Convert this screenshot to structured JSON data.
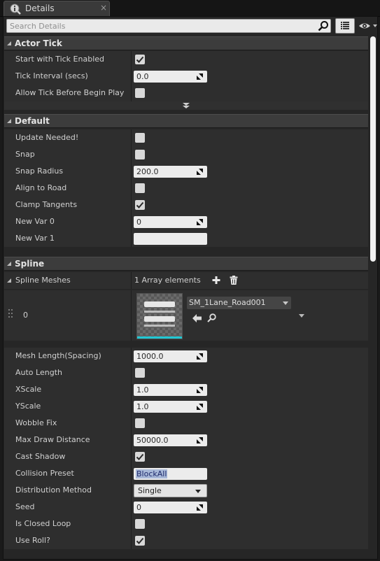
{
  "tab": {
    "title": "Details",
    "close_glyph": "×"
  },
  "search": {
    "placeholder": "Search Details",
    "value": ""
  },
  "icons": {
    "tab": "details-info-icon",
    "search": "magnifier-icon",
    "view_options": "list-view-icon",
    "visibility": "eye-icon"
  },
  "sections": {
    "actor_tick": {
      "title": "Actor Tick",
      "start_with_tick": {
        "label": "Start with Tick Enabled",
        "checked": true
      },
      "tick_interval": {
        "label": "Tick Interval (secs)",
        "value": "0.0"
      },
      "allow_tick": {
        "label": "Allow Tick Before Begin Play",
        "checked": false
      }
    },
    "default": {
      "title": "Default",
      "update_needed": {
        "label": "Update Needed!",
        "checked": false
      },
      "snap": {
        "label": "Snap",
        "checked": false
      },
      "snap_radius": {
        "label": "Snap Radius",
        "value": "200.0"
      },
      "align_to_road": {
        "label": "Align to Road",
        "checked": false
      },
      "clamp_tangents": {
        "label": "Clamp Tangents",
        "checked": true
      },
      "new_var_0": {
        "label": "New Var 0",
        "value": "0"
      },
      "new_var_1": {
        "label": "New Var 1",
        "value": ""
      }
    },
    "spline": {
      "title": "Spline",
      "spline_meshes": {
        "label": "Spline Meshes",
        "count_text": "1 Array elements"
      },
      "mesh_element": {
        "index": "0",
        "mesh_name": "SM_1Lane_Road001"
      },
      "mesh_length": {
        "label": "Mesh Length(Spacing)",
        "value": "1000.0"
      },
      "auto_length": {
        "label": "Auto Length",
        "checked": false
      },
      "xscale": {
        "label": "XScale",
        "value": "1.0"
      },
      "yscale": {
        "label": "YScale",
        "value": "1.0"
      },
      "wobble_fix": {
        "label": "Wobble Fix",
        "checked": false
      },
      "max_draw_distance": {
        "label": "Max Draw Distance",
        "value": "50000.0"
      },
      "cast_shadow": {
        "label": "Cast Shadow",
        "checked": true
      },
      "collision_preset": {
        "label": "Collision Preset",
        "value": "BlockAll"
      },
      "distribution_method": {
        "label": "Distribution Method",
        "value": "Single"
      },
      "seed": {
        "label": "Seed",
        "value": "0"
      },
      "is_closed_loop": {
        "label": "Is Closed Loop",
        "checked": false
      },
      "use_roll": {
        "label": "Use Roll?",
        "checked": true
      }
    }
  },
  "colors": {
    "panel": "#262626",
    "row": "#2e2e2e",
    "header": "#3c3c3c",
    "field": "#ececec",
    "selection": "#a8b8d8",
    "thumb_accent": "#21c8d4"
  }
}
